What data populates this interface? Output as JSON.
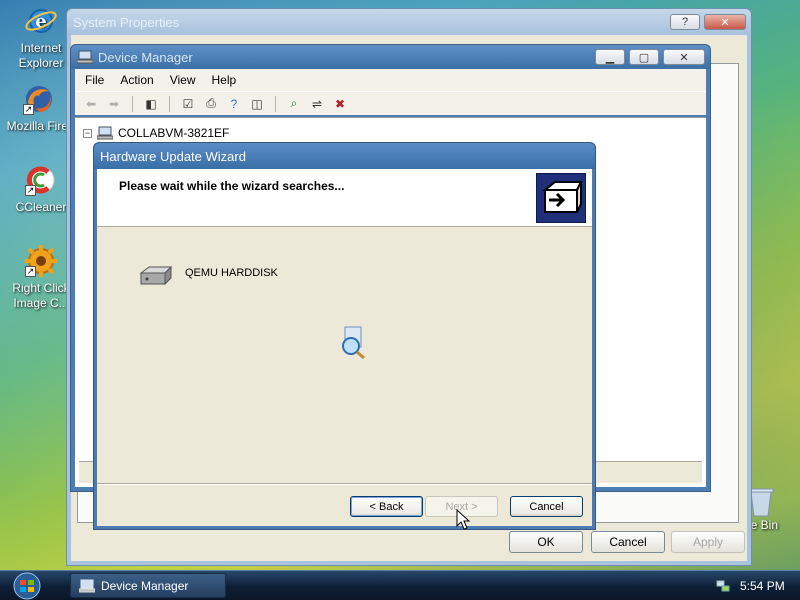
{
  "desktop": {
    "icons": [
      {
        "label": "Internet Explorer",
        "icon": "internet-explorer-icon"
      },
      {
        "label": "Mozilla Firef",
        "icon": "firefox-icon"
      },
      {
        "label": "CCleaner",
        "icon": "ccleaner-icon"
      },
      {
        "label": "Right Click Image C...",
        "icon": "gear-icon"
      }
    ],
    "recycle_bin_label": "cle Bin"
  },
  "system_properties": {
    "title": "System Properties",
    "buttons": {
      "ok": "OK",
      "cancel": "Cancel",
      "apply": "Apply"
    },
    "title_buttons": {
      "help": "?",
      "close": "✕"
    }
  },
  "device_manager": {
    "title": "Device Manager",
    "menu": [
      "File",
      "Action",
      "View",
      "Help"
    ],
    "tree_root": "COLLABVM-3821EF",
    "expander": "−",
    "title_buttons": {
      "minimize": "▁",
      "maximize": "▢",
      "close": "✕"
    }
  },
  "wizard": {
    "title": "Hardware Update Wizard",
    "header_text": "Please wait while the wizard searches...",
    "device_name": "QEMU HARDDISK",
    "buttons": {
      "back": "< Back",
      "next": "Next >",
      "cancel": "Cancel"
    }
  },
  "taskbar": {
    "task_label": "Device Manager",
    "clock": "5:54 PM"
  },
  "colors": {
    "title_active": "#3b6fa6",
    "dialog_bg": "#ece9d8",
    "taskbar": "#0e1f36"
  }
}
